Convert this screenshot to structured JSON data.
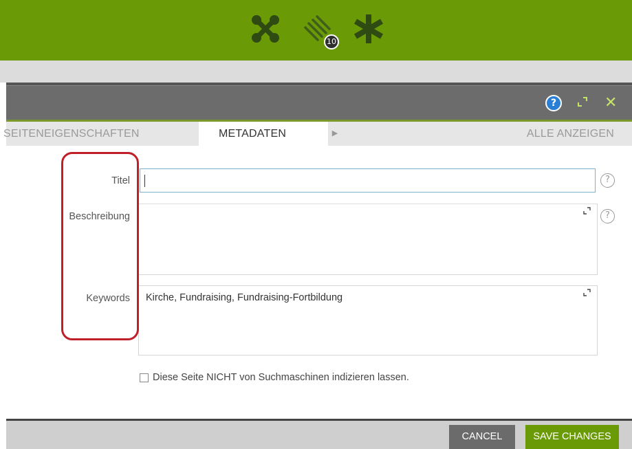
{
  "toolbar": {
    "icons": [
      "structure-icon",
      "tag-icon",
      "asterisk-icon"
    ],
    "badge_count": "10",
    "color": "#6a9a06"
  },
  "dialog": {
    "header_icons": [
      "help-icon",
      "expand-icon",
      "close-icon"
    ],
    "tabs": [
      {
        "label": "SEITENEIGENSCHAFTEN",
        "active": false
      },
      {
        "label": "METADATEN",
        "active": true
      }
    ],
    "show_all_label": "ALLE ANZEIGEN",
    "fields": {
      "title_label": "Titel",
      "title_value": "",
      "description_label": "Beschreibung",
      "description_value": "",
      "keywords_label": "Keywords",
      "keywords_value": "Kirche, Fundraising, Fundraising-Fortbildung"
    },
    "noindex_label": "Diese Seite NICHT von Suchmaschinen indizieren lassen.",
    "noindex_checked": false,
    "cancel_label": "CANCEL",
    "save_label": "SAVE CHANGES",
    "highlight_color": "#c01f2a"
  }
}
